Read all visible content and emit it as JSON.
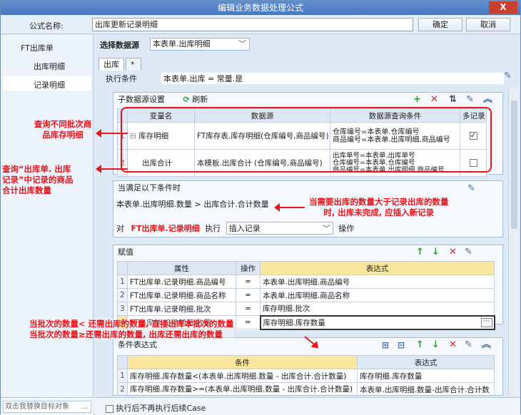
{
  "window": {
    "title": "编辑业务数据处理公式",
    "close": "X"
  },
  "name_row": {
    "label": "公式名称:",
    "value": "出库更新记录明细",
    "ok": "确定",
    "cancel": "取消"
  },
  "left": {
    "root": "FT出库单",
    "items": [
      "出库明细",
      "记录明细"
    ],
    "replace_placeholder": "双击我替换目标对象",
    "replace_btn": "..."
  },
  "datasource": {
    "label": "选择数据源",
    "value": "本表单.出库明细",
    "tab": "出库",
    "tab_add": "*"
  },
  "exec_cond": {
    "label": "执行条件",
    "value": "本表单.出库 = 常量.是"
  },
  "sub_ds": {
    "title": "子数据源设置",
    "refresh": "刷新",
    "headers": [
      "变量名",
      "数据源",
      "数据源查询条件",
      "多记录"
    ],
    "rows": [
      {
        "n": "1",
        "var": "库存明细",
        "src": "FT库存表.库存明细(仓库编号,商品编号)",
        "cond": [
          "仓库编号=本表单.仓库编号",
          "商品编号=本表单.出库明细.商品编号"
        ],
        "multi": true
      },
      {
        "n": "2",
        "var": "出库合计",
        "src": "本模板.出库合计 (仓库编号,商品编号)",
        "cond": [
          "出库单号=本表单.出库单号",
          "仓库编号=本表单.仓库编号",
          "商品编号=本表单.出库明细.商品编号"
        ],
        "multi": false
      }
    ]
  },
  "when": {
    "title": "当满足以下条件时",
    "expr": "本表单.出库明细.数量 > 出库合计.合计数量",
    "prefix": "对",
    "target": "FT出库单.记录明细",
    "exec": "执行",
    "action": "插入记录",
    "suffix": "操作"
  },
  "assign": {
    "title": "赋值",
    "headers": [
      "属性",
      "操作",
      "表达式"
    ],
    "rows": [
      {
        "n": "1",
        "attr": "FT出库单.记录明细.商品编号",
        "op": "=",
        "expr": "本表单.出库明细.商品编号"
      },
      {
        "n": "2",
        "attr": "FT出库单.记录明细.商品名称",
        "op": "=",
        "expr": "本表单.出库明细.商品名称"
      },
      {
        "n": "3",
        "attr": "FT出库单.记录明细.批次",
        "op": "=",
        "expr": "库存明细.批次"
      },
      {
        "n": "4",
        "attr": "FT出库单.记录明细.数量",
        "op": "=",
        "expr": "库存明细.库存数量"
      }
    ]
  },
  "condexpr": {
    "title": "条件表达式",
    "headers": [
      "条件",
      "表达式"
    ],
    "rows": [
      {
        "n": "1",
        "cond": "库存明细.库存数量<(本表单.出库明细.数量 - 出库合计.合计数量)",
        "expr": "库存明细.库存数量"
      },
      {
        "n": "2",
        "cond": "库存明细.库存数量>=(本表单.出库明细.数量 - 出库合计.合计数量)",
        "expr": "本表单.出库明细.数量-出库合计.合计数"
      },
      {
        "n": "3",
        "cond": "",
        "expr": ""
      }
    ]
  },
  "footer": {
    "label": "执行后不再执行后续Case"
  },
  "annotations": {
    "a1": "查询不同批次商\n品库存明细",
    "a2": "查询“出库单. 出库\n记录”中记录的商品\n合计出库数量",
    "a3": "当需要出库的数量大于记录出库的数量\n时, 出库未完成, 应插入新记录",
    "a4": "当批次的数量< 还需出库的数量, 直接出库本批次的数量\n当批次的数量≥还需出库的数量, 出库还需出库的数量"
  }
}
